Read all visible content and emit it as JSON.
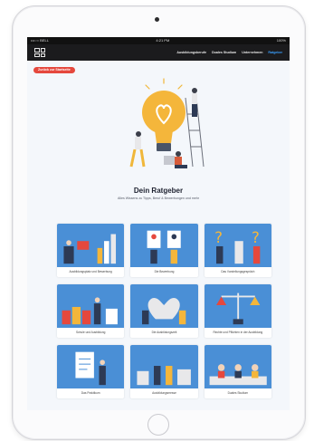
{
  "statusbar": {
    "carrier": "•••○○ BELL",
    "time": "4:21 PM",
    "battery": "100%"
  },
  "nav": {
    "logo": "logo-icon",
    "links": [
      {
        "label": "Ausbildungsberufe"
      },
      {
        "label": "Duales Studium"
      },
      {
        "label": "Unternehmen"
      },
      {
        "label": "Ratgeber"
      }
    ]
  },
  "back_button": {
    "label": "Zurück zur Startseite"
  },
  "hero": {
    "title": "Dein Ratgeber",
    "subtitle": "Alles Wissens zu Tipps, Beruf & Bewerbungen und mehr"
  },
  "cards": [
    {
      "label": "Ausbildungsplatz und Bewerbung"
    },
    {
      "label": "Die Bewerbung"
    },
    {
      "label": "Das Vorstellungsgespräch"
    },
    {
      "label": "Schule und Ausbildung"
    },
    {
      "label": "Die Ausbildungszeit"
    },
    {
      "label": "Rechte und Pflichten in der Ausbildung"
    },
    {
      "label": "Das Praktikum"
    },
    {
      "label": "Ausbildungsmesse"
    },
    {
      "label": "Duales Studium"
    }
  ],
  "colors": {
    "accent": "#3aa0ff",
    "back_button": "#e5483d",
    "card_art": "#4a8fd6",
    "navbar": "#1b1b1d"
  }
}
